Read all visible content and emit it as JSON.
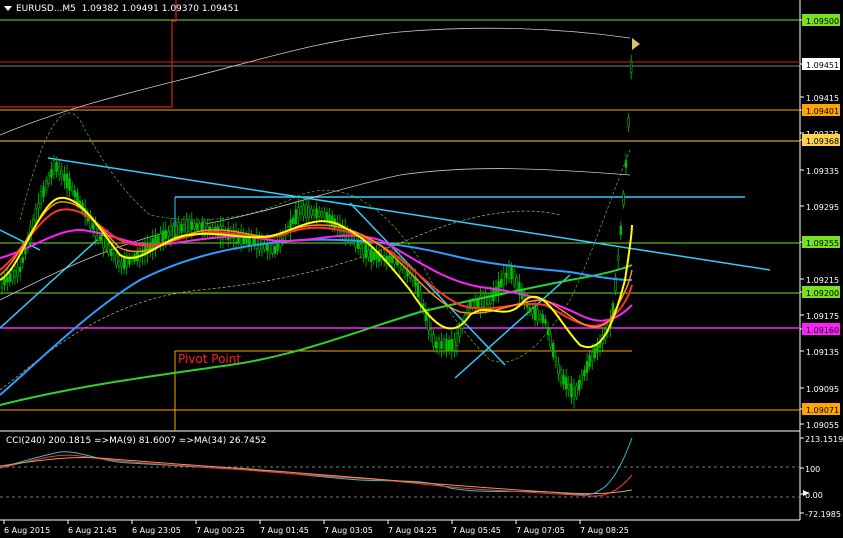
{
  "header": {
    "menu_icon": "triangle-down-icon",
    "symbol": "EURUSD...M5",
    "ohlc": "1.09382 1.09491 1.09370 1.09451"
  },
  "indicator_header": "CCI(240) 200.1815  =>MA(9) 81.6007  =>MA(34) 26.7452",
  "pivot_label": "Pivot Point",
  "price_axis": {
    "ticks": [
      "1.09500",
      "1.09451",
      "1.09415",
      "1.09401",
      "1.09375",
      "1.09368",
      "1.09335",
      "1.09295",
      "1.09255",
      "1.09215",
      "1.09200",
      "1.09175",
      "1.09160",
      "1.09135",
      "1.09095",
      "1.09071",
      "1.09055"
    ],
    "highlighted": [
      {
        "label": "1.09500",
        "bg": "#78e01e",
        "fg": "#000000"
      },
      {
        "label": "1.09451",
        "bg": "#ffffff",
        "fg": "#000000"
      },
      {
        "label": "1.09401",
        "bg": "#ffa500",
        "fg": "#000000"
      },
      {
        "label": "1.09368",
        "bg": "#ffd24a",
        "fg": "#000000"
      },
      {
        "label": "1.09255",
        "bg": "#78e01e",
        "fg": "#000000"
      },
      {
        "label": "1.09200",
        "bg": "#78e01e",
        "fg": "#000000"
      },
      {
        "label": "1.09160",
        "bg": "#ff20ff",
        "fg": "#000000"
      },
      {
        "label": "1.09071",
        "bg": "#ffa500",
        "fg": "#000000"
      }
    ]
  },
  "indicator_axis": {
    "ticks": [
      "213.1519",
      "100",
      "0.00",
      "-72.1985"
    ]
  },
  "time_axis": {
    "labels": [
      "6 Aug 2015",
      "6 Aug 21:45",
      "6 Aug 23:05",
      "7 Aug 00:25",
      "7 Aug 01:45",
      "7 Aug 03:05",
      "7 Aug 04:25",
      "7 Aug 05:45",
      "7 Aug 07:05",
      "7 Aug 08:25"
    ]
  },
  "colors": {
    "background": "#000000",
    "axis": "#ffffff",
    "grid_dash": "#c0c0c0",
    "candles": "#00c000",
    "green_level": "#78e01e",
    "red_level": "#d02020",
    "orange_level": "#ffa500",
    "magenta_level": "#ff20ff",
    "cyan_trend": "#33ccff",
    "yellow_ma": "#ffff00",
    "red_ma": "#ff2020",
    "magenta_ma": "#ff20ff",
    "blue_ma": "#2f9cff",
    "green_ma": "#30d030"
  }
}
